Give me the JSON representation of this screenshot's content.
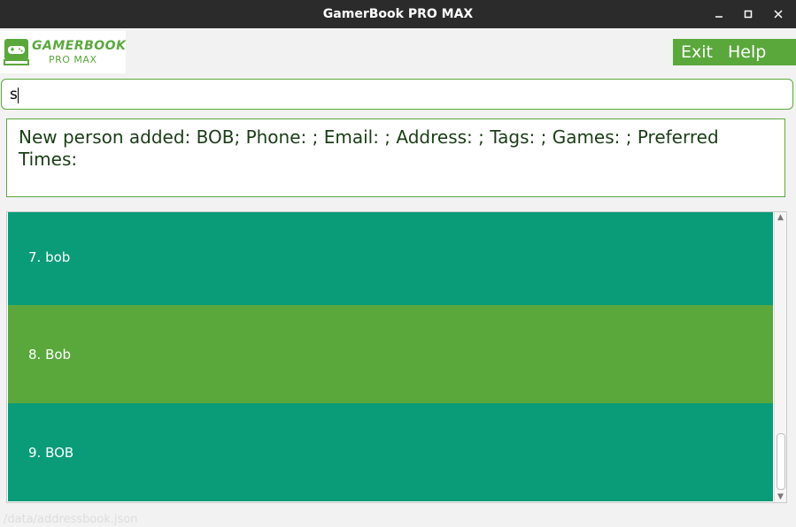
{
  "window": {
    "title": "GamerBook PRO MAX",
    "controls": [
      "minimize",
      "maximize",
      "close"
    ]
  },
  "header": {
    "logo_line1": "GAMERBOOK",
    "logo_line2": "PRO MAX",
    "menu": {
      "exit_label": "Exit",
      "help_label": "Help"
    }
  },
  "command_box": {
    "value": "s"
  },
  "result_display": {
    "text": "New person added: BOB; Phone: ; Email: ; Address: ; Tags: ; Games: ; Preferred Times:"
  },
  "person_list": {
    "items": [
      {
        "index": "7.",
        "name": "bob"
      },
      {
        "index": "8.",
        "name": "Bob"
      },
      {
        "index": "9.",
        "name": "BOB"
      }
    ]
  },
  "status_bar": {
    "path": "/data/addressbook.json"
  },
  "colors": {
    "accent": "#5aa83c",
    "teal": "#0a9b78",
    "titlebar": "#2b2b2b"
  }
}
